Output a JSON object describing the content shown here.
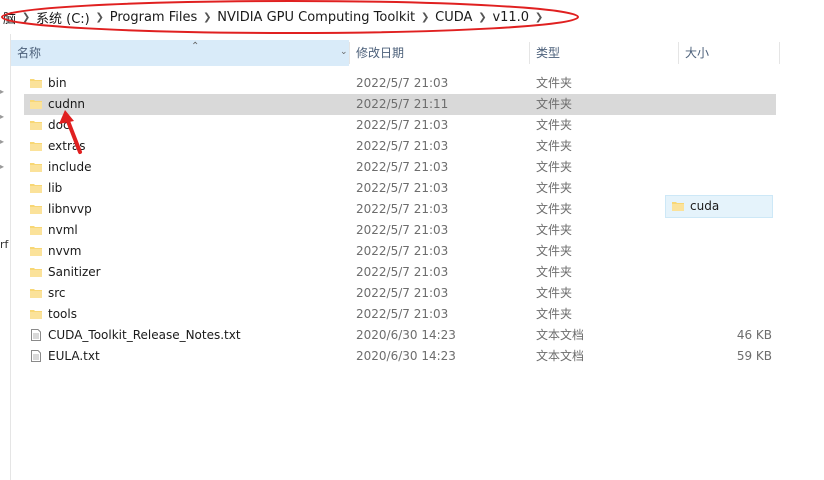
{
  "breadcrumb": {
    "items": [
      "脑",
      "系统 (C:)",
      "Program Files",
      "NVIDIA GPU Computing Toolkit",
      "CUDA",
      "v11.0"
    ]
  },
  "nav": {
    "partial_label": "rf"
  },
  "columns": {
    "name": "名称",
    "date": "修改日期",
    "type": "类型",
    "size": "大小"
  },
  "files": [
    {
      "name": "bin",
      "date": "2022/5/7 21:03",
      "type": "文件夹",
      "size": "",
      "icon": "folder-icon"
    },
    {
      "name": "cudnn",
      "date": "2022/5/7 21:11",
      "type": "文件夹",
      "size": "",
      "icon": "folder-icon",
      "selected": true
    },
    {
      "name": "doc",
      "date": "2022/5/7 21:03",
      "type": "文件夹",
      "size": "",
      "icon": "folder-icon"
    },
    {
      "name": "extras",
      "date": "2022/5/7 21:03",
      "type": "文件夹",
      "size": "",
      "icon": "folder-icon"
    },
    {
      "name": "include",
      "date": "2022/5/7 21:03",
      "type": "文件夹",
      "size": "",
      "icon": "folder-icon"
    },
    {
      "name": "lib",
      "date": "2022/5/7 21:03",
      "type": "文件夹",
      "size": "",
      "icon": "folder-icon"
    },
    {
      "name": "libnvvp",
      "date": "2022/5/7 21:03",
      "type": "文件夹",
      "size": "",
      "icon": "folder-icon"
    },
    {
      "name": "nvml",
      "date": "2022/5/7 21:03",
      "type": "文件夹",
      "size": "",
      "icon": "folder-icon"
    },
    {
      "name": "nvvm",
      "date": "2022/5/7 21:03",
      "type": "文件夹",
      "size": "",
      "icon": "folder-icon"
    },
    {
      "name": "Sanitizer",
      "date": "2022/5/7 21:03",
      "type": "文件夹",
      "size": "",
      "icon": "folder-icon"
    },
    {
      "name": "src",
      "date": "2022/5/7 21:03",
      "type": "文件夹",
      "size": "",
      "icon": "folder-icon"
    },
    {
      "name": "tools",
      "date": "2022/5/7 21:03",
      "type": "文件夹",
      "size": "",
      "icon": "folder-icon"
    },
    {
      "name": "CUDA_Toolkit_Release_Notes.txt",
      "date": "2020/6/30 14:23",
      "type": "文本文档",
      "size": "46 KB",
      "icon": "text-file-icon"
    },
    {
      "name": "EULA.txt",
      "date": "2020/6/30 14:23",
      "type": "文本文档",
      "size": "59 KB",
      "icon": "text-file-icon"
    }
  ],
  "drag_ghost": {
    "label": "cuda",
    "icon": "folder-icon"
  },
  "colors": {
    "selection": "#d9d9d9",
    "header_selected": "#d9ebf9",
    "annotation": "#e02020",
    "folder": "#f8d775"
  }
}
